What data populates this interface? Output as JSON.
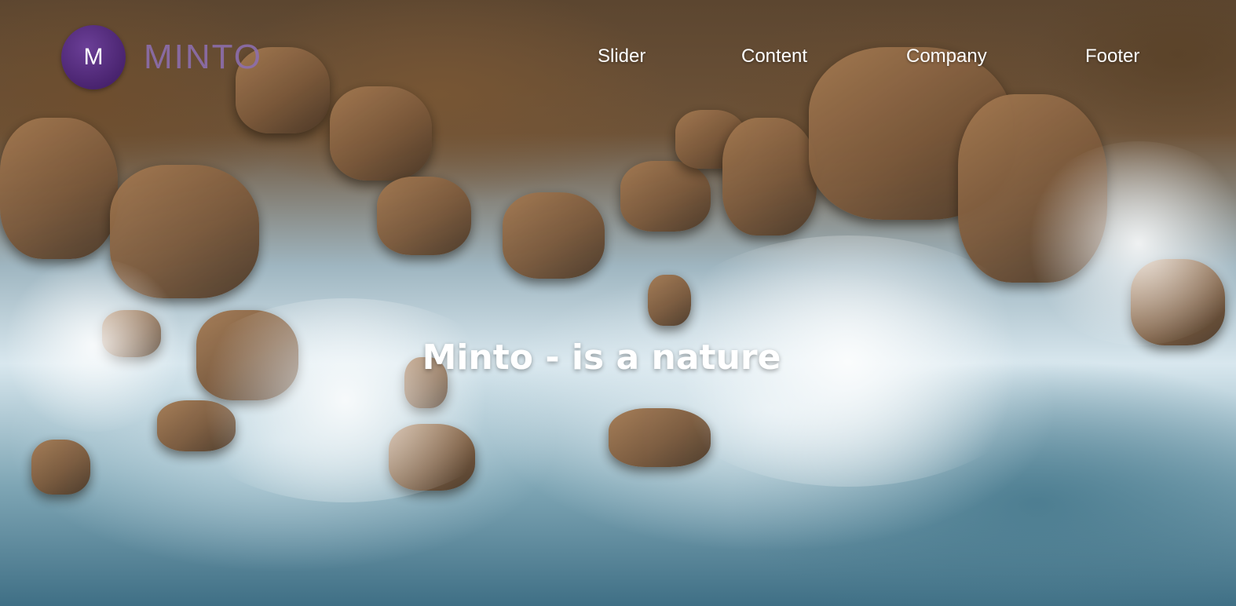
{
  "header": {
    "logo_letter": "M",
    "brand_name": "MINTO",
    "nav": [
      {
        "label": "Slider"
      },
      {
        "label": "Content"
      },
      {
        "label": "Company"
      },
      {
        "label": "Footer"
      }
    ]
  },
  "hero": {
    "headline": "Minto - is a nature",
    "background": "aerial-ocean-rocks-image"
  },
  "colors": {
    "logo_circle": "#4a2470",
    "brand_text": "#8d6fb0",
    "nav_text": "#ffffff",
    "headline_text": "#ffffff"
  }
}
